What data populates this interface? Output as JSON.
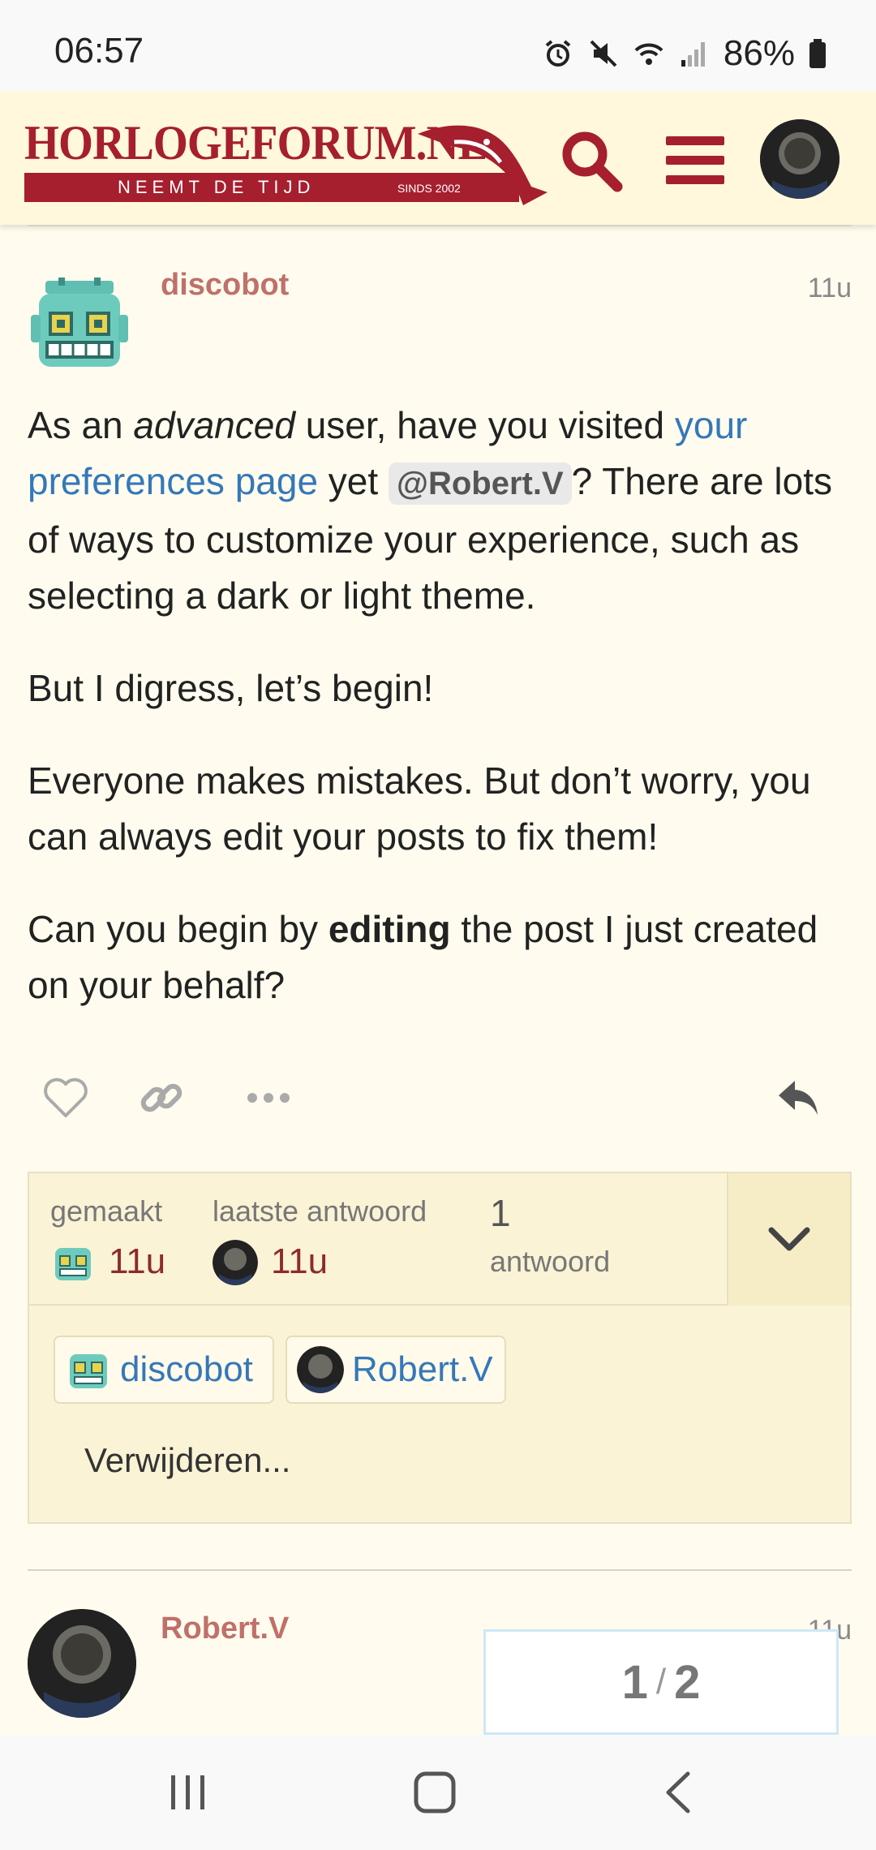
{
  "status_bar": {
    "time": "06:57",
    "battery": "86%",
    "icons": [
      "alarm-icon",
      "mute-icon",
      "wifi-icon",
      "signal-icon",
      "battery-icon"
    ]
  },
  "header": {
    "logo_text": "HORLOGEFORUM.NL",
    "tagline": "NEEMT DE TIJD",
    "since": "SINDS 2002",
    "colors": {
      "brand": "#a51f2f",
      "background": "#fff8dc"
    }
  },
  "posts": [
    {
      "username": "discobot",
      "date": "11u",
      "body": {
        "p1_a": "As an ",
        "p1_em": "advanced",
        "p1_b": " user, have you visited ",
        "p1_link": "your preferences page",
        "p1_c": " yet ",
        "p1_mention": "@Robert.V",
        "p1_d": "? There are lots of ways to customize your experience, such as selecting a dark or light theme.",
        "p2": "But I digress, let’s begin!",
        "p3": "Everyone makes mistakes. But don’t worry, you can always edit your posts to fix them!",
        "p4_a": "Can you begin by ",
        "p4_strong": "editing",
        "p4_b": " the post I just created on your behalf?"
      }
    },
    {
      "username": "Robert.V",
      "date": "11u"
    }
  ],
  "topic_map": {
    "created_label": "gemaakt",
    "created_value": "11u",
    "last_reply_label": "laatste antwoord",
    "last_reply_value": "11u",
    "replies_count": "1",
    "replies_label": "antwoord",
    "participants": [
      "discobot",
      "Robert.V"
    ],
    "delete_label": "Verwijderen..."
  },
  "progress": {
    "current": "1",
    "total": "2"
  }
}
